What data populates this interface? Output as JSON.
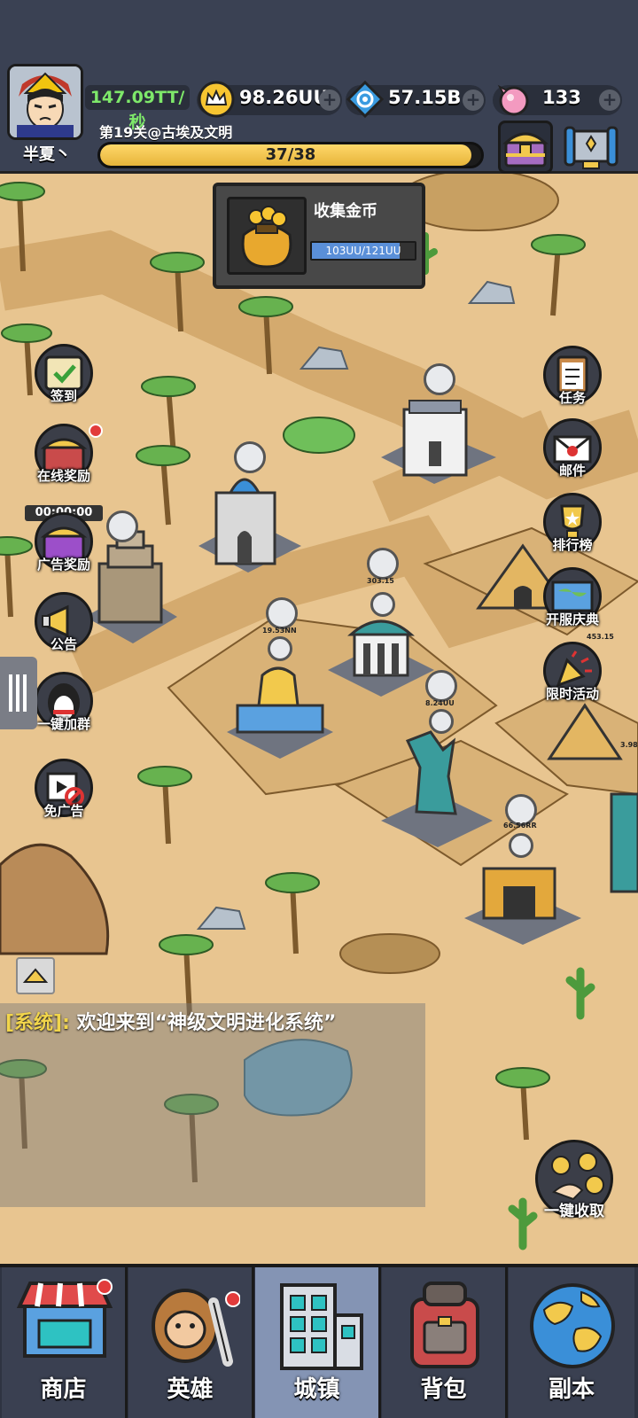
{
  "player": {
    "name": "半夏丶",
    "income_rate": "147.09TT/秒"
  },
  "resources": [
    {
      "name": "gold",
      "icon": "crown-icon",
      "value": "98.26UU"
    },
    {
      "name": "gem",
      "icon": "blue-diamond-icon",
      "value": "57.15B"
    },
    {
      "name": "candy",
      "icon": "pink-candy-icon",
      "value": "133"
    }
  ],
  "level": {
    "label": "第19关@古埃及文明",
    "progress_text": "37/38",
    "progress": 0.974
  },
  "quest": {
    "title": "收集金币",
    "progress_text": "103UU/121UU",
    "progress": 0.85
  },
  "left_menu": [
    {
      "label": "签到"
    },
    {
      "label": "在线奖励",
      "timer": "00:00:00"
    },
    {
      "label": "广告奖励"
    },
    {
      "label": "公告"
    },
    {
      "label": "一键加群"
    },
    {
      "label": "免广告"
    }
  ],
  "right_menu": [
    {
      "label": "任务"
    },
    {
      "label": "邮件"
    },
    {
      "label": "排行榜"
    },
    {
      "label": "开服庆典"
    },
    {
      "label": "限时活动"
    }
  ],
  "chat": {
    "tag": "[系统]:",
    "message": " 欢迎来到“神级文明进化系统”"
  },
  "collect_all": {
    "label": "一键收取"
  },
  "nav": [
    {
      "label": "商店"
    },
    {
      "label": "英雄"
    },
    {
      "label": "城镇"
    },
    {
      "label": "背包"
    },
    {
      "label": "副本"
    }
  ],
  "building_values": [
    "303.15",
    "19.53NN",
    "8.24UU",
    "66.56RR",
    "453.15",
    "3.98"
  ],
  "colors": {
    "topbar": "#3a4153",
    "accent_gold": "#f1d54b",
    "income_green": "#7ee86a",
    "sand": "#e8c590"
  }
}
